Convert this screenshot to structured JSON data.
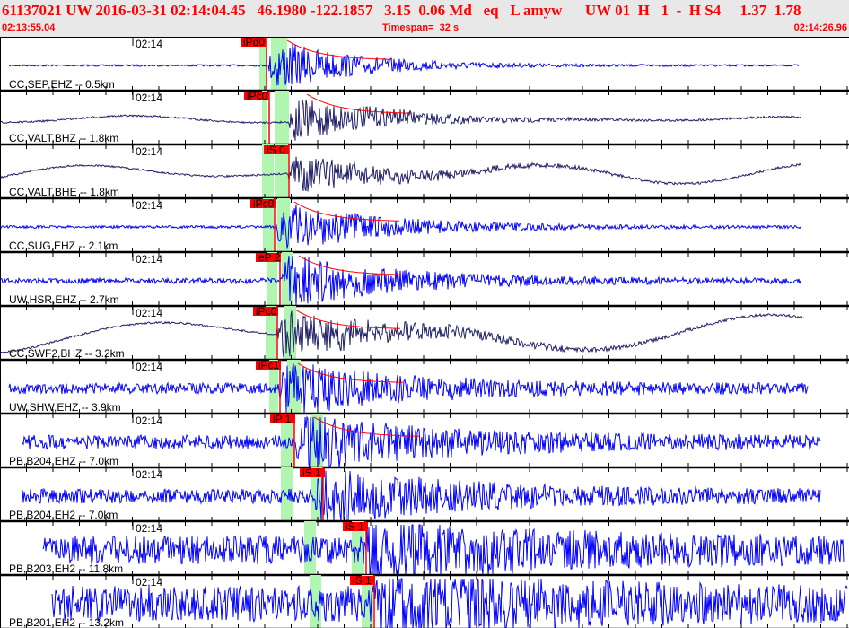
{
  "header": {
    "title": "61137021 UW 2016-03-31 02:14:04.45   46.1980 -122.1857   3.15  0.06 Md   eq   L amyw      UW 01  H   1  -  H S4     1.37  1.78",
    "start_time": "02:13:55.04",
    "timespan": "Timespan=  32 s",
    "end_time": "02:14:26.96"
  },
  "colors": {
    "header_text": "#ff0000",
    "pick": "#ff0000",
    "window": "#b0f5b0",
    "trace_blue": "#0000ff",
    "trace_navy": "#20206a"
  },
  "time_tick_label": "02:14",
  "traces": [
    {
      "station": "CC,SEP,EHZ -- 0.5km",
      "pick": "iPd0",
      "color": "trace_blue"
    },
    {
      "station": "CC,VALT,BHZ -- 1.8km",
      "pick": "iPc0",
      "color": "trace_navy"
    },
    {
      "station": "CC,VALT,BHE -- 1.8km",
      "pick": "iS 0",
      "color": "trace_navy"
    },
    {
      "station": "CC,SUG,EHZ -- 2.1km",
      "pick": "iPc0",
      "color": "trace_blue"
    },
    {
      "station": "UW,HSR,EHZ -- 2.7km",
      "pick": "eP 2",
      "color": "trace_blue"
    },
    {
      "station": "CC,SWF2,BHZ -- 3.2km",
      "pick": "iPc0",
      "color": "trace_navy"
    },
    {
      "station": "UW,SHW,EHZ -- 3.9km",
      "pick": "iPc1",
      "color": "trace_blue"
    },
    {
      "station": "PB,B204,EHZ -- 7.0km",
      "pick": "iP 1",
      "color": "trace_blue"
    },
    {
      "station": "PB,B204,EH2 -- 7.0km",
      "pick": "iS 1",
      "color": "trace_blue"
    },
    {
      "station": "PB,B203,EH2 -- 11.8km",
      "pick": "iS 1",
      "color": "trace_blue"
    },
    {
      "station": "PB,B201,EH2 -- 13.2km",
      "pick": "iS 1",
      "color": "trace_blue"
    }
  ]
}
